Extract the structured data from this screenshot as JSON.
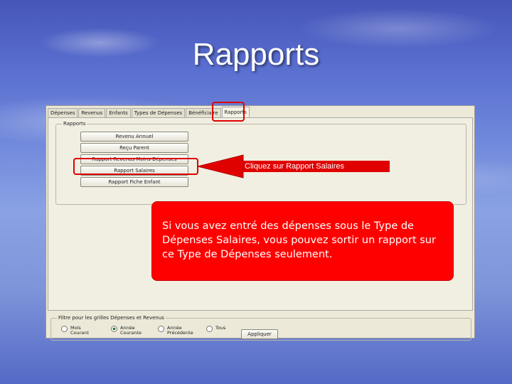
{
  "slide": {
    "title": "Rapports"
  },
  "tabs": [
    "Dépenses",
    "Revenus",
    "Enfants",
    "Types de Dépenses",
    "Bénéficiaire",
    "Rapports"
  ],
  "report_group": {
    "label": "Rapports",
    "buttons": [
      "Revenu Annuel",
      "Reçu Parent",
      "Rapport Revenus Moins Dépenses",
      "Rapport Salaires",
      "Rapport Fiche Enfant"
    ]
  },
  "filter": {
    "label": "Filtre pour les grilles Dépenses et Revenus",
    "options": [
      {
        "line1": "Mois",
        "line2": "Courant",
        "selected": false
      },
      {
        "line1": "Année",
        "line2": "Courante",
        "selected": true
      },
      {
        "line1": "Année",
        "line2": "Précédente",
        "selected": false
      },
      {
        "line1": "Tous",
        "line2": "",
        "selected": false
      }
    ],
    "apply_label": "Appliquer"
  },
  "callout": {
    "text": "Cliquez sur Rapport Salaires"
  },
  "info": {
    "text": "Si vous avez entré des dépenses sous le Type de Dépenses Salaires, vous pouvez sortir un rapport sur ce Type de Dépenses seulement."
  },
  "colors": {
    "highlight": "#e00000",
    "info_bg": "#ff0000",
    "window_bg": "#ece9d8"
  }
}
